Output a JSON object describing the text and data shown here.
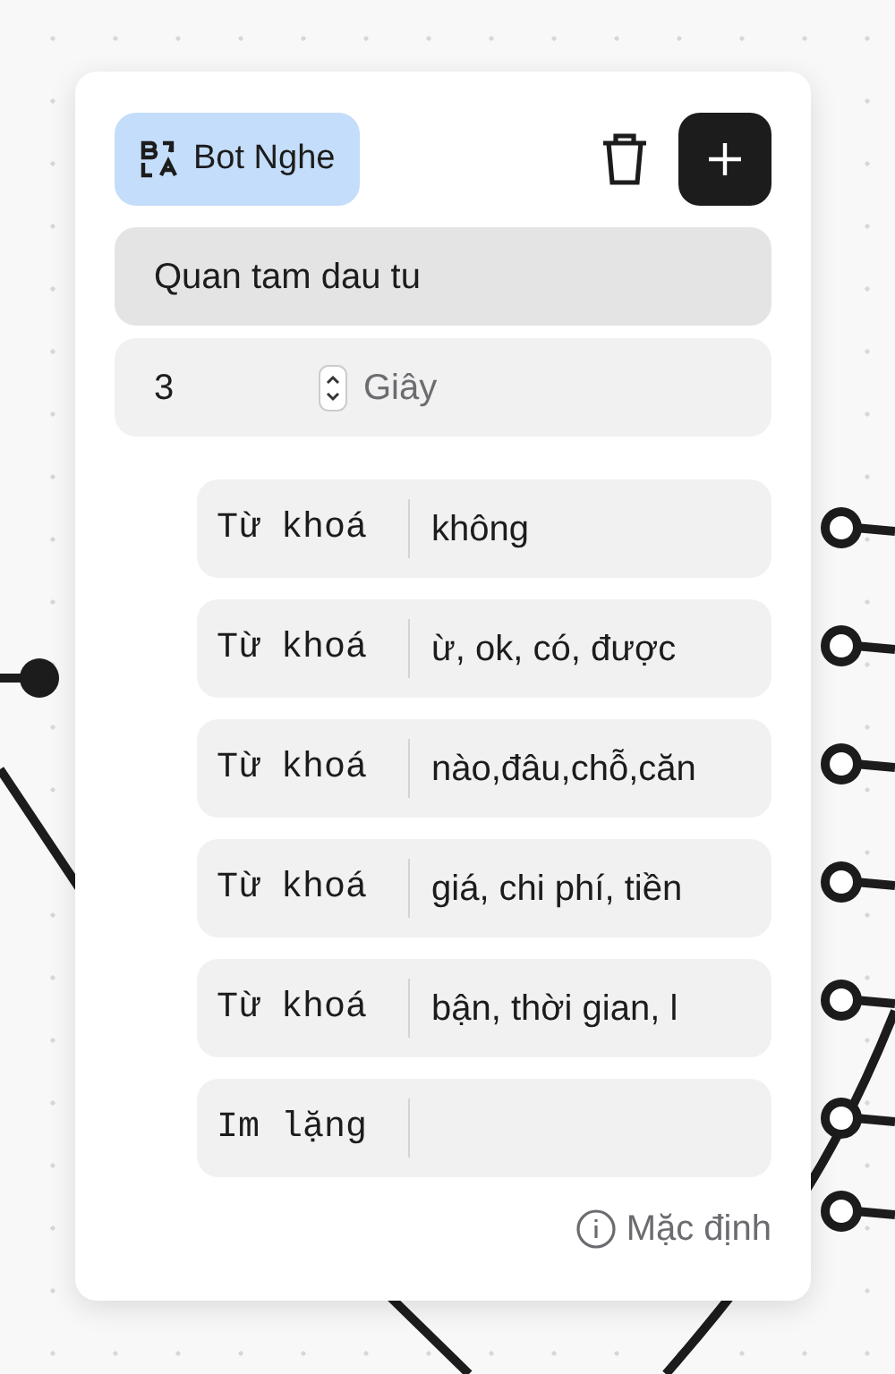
{
  "node": {
    "badge": "Bot Nghe",
    "name_value": "Quan tam dau tu",
    "timeout": {
      "value": "3",
      "unit": "Giây"
    },
    "branches": [
      {
        "kind": "keyword",
        "label": "Từ khoá",
        "value": "không"
      },
      {
        "kind": "keyword",
        "label": "Từ khoá",
        "value": "ừ, ok, có, được"
      },
      {
        "kind": "keyword",
        "label": "Từ khoá",
        "value": "nào,đâu,chỗ,căn"
      },
      {
        "kind": "keyword",
        "label": "Từ khoá",
        "value": "giá, chi phí, tiền"
      },
      {
        "kind": "keyword",
        "label": "Từ khoá",
        "value": "bận, thời gian, l"
      },
      {
        "kind": "silence",
        "label": "Im lặng"
      }
    ],
    "default_label": "Mặc định"
  }
}
